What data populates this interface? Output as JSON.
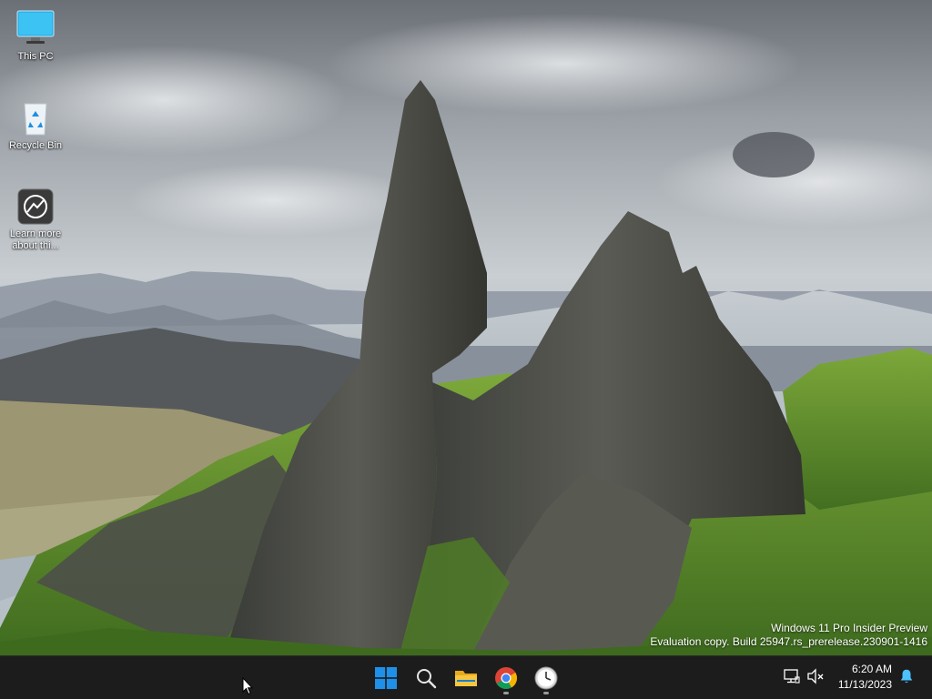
{
  "desktop": {
    "icons": [
      {
        "label": "This PC",
        "icon": "monitor-icon"
      },
      {
        "label": "Recycle Bin",
        "icon": "recycle-bin-icon"
      },
      {
        "label": "Learn more about thi...",
        "icon": "learn-more-icon"
      }
    ],
    "watermark": {
      "line1": "Windows 11 Pro Insider Preview",
      "line2": "Evaluation copy. Build 25947.rs_prerelease.230901-1416"
    }
  },
  "taskbar": {
    "apps": [
      {
        "name": "start",
        "icon": "windows-logo-icon",
        "running": false
      },
      {
        "name": "search",
        "icon": "search-icon",
        "running": false
      },
      {
        "name": "file-explorer",
        "icon": "folder-icon",
        "running": false
      },
      {
        "name": "chrome",
        "icon": "chrome-icon",
        "running": true
      },
      {
        "name": "clock-app",
        "icon": "clock-icon",
        "running": true
      }
    ],
    "tray": {
      "network_icon": "network-icon",
      "volume_icon": "volume-muted-icon",
      "time": "6:20 AM",
      "date": "11/13/2023",
      "notification_icon": "bell-icon"
    }
  },
  "colors": {
    "taskbar": "#1c1c1c",
    "accent": "#4cc2ff",
    "start_blue": "#1e90e8"
  }
}
